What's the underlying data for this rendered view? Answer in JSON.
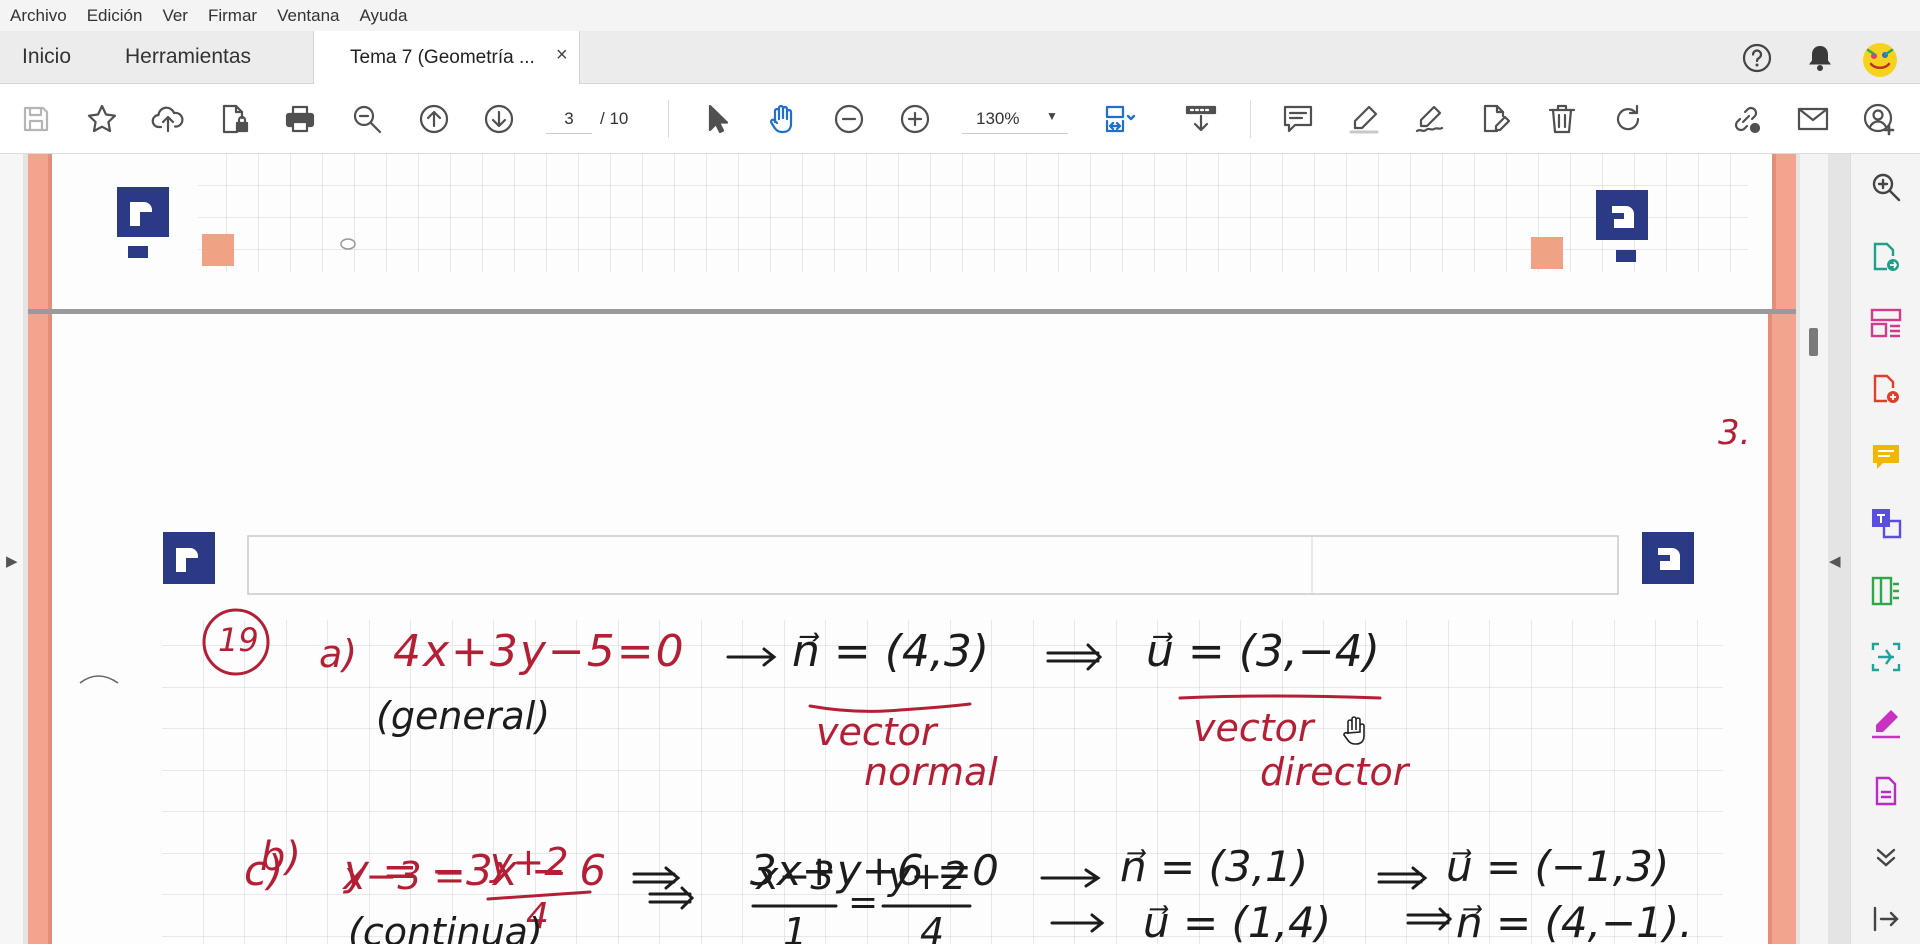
{
  "menu": [
    "Archivo",
    "Edición",
    "Ver",
    "Firmar",
    "Ventana",
    "Ayuda"
  ],
  "tabs": {
    "home": "Inicio",
    "tools": "Herramientas",
    "document": "Tema 7 (Geometría ...",
    "close": "×"
  },
  "toolbar": {
    "page_current": "3",
    "page_total": "/ 10",
    "zoom": "130%"
  },
  "document": {
    "page_number": "3.",
    "problem": "19",
    "a": {
      "label": "a)",
      "equation": "4x+3y−5=0",
      "type": "(general)",
      "normal": "n⃗ = (4,3)",
      "director": "u⃗ = (3,−4)",
      "normal_caption_1": "vector",
      "normal_caption_2": "normal",
      "director_caption_1": "vector",
      "director_caption_2": "director"
    },
    "b": {
      "label": "b)",
      "lhs": "x−3 =",
      "num": "y+2",
      "den": "4",
      "type": "(continua)",
      "frac1_num": "x−3",
      "frac1_den": "1",
      "eq": "=",
      "frac2_num": "y+2",
      "frac2_den": "4",
      "director": "u⃗ = (1,4)",
      "normal": "n⃗ = (4,−1)."
    },
    "c": {
      "label": "c)",
      "equation": "y = −3x − 6",
      "general": "3x+y+6 =0",
      "normal": "n⃗ = (3,1)",
      "director": "u⃗ = (−1,3)"
    }
  },
  "colors": {
    "red_ink": "#b51f35",
    "black_ink": "#1c1c1c",
    "accent_blue": "#2b3a85",
    "page_border": "#f2a48f",
    "grid": "#cfd4dc"
  }
}
